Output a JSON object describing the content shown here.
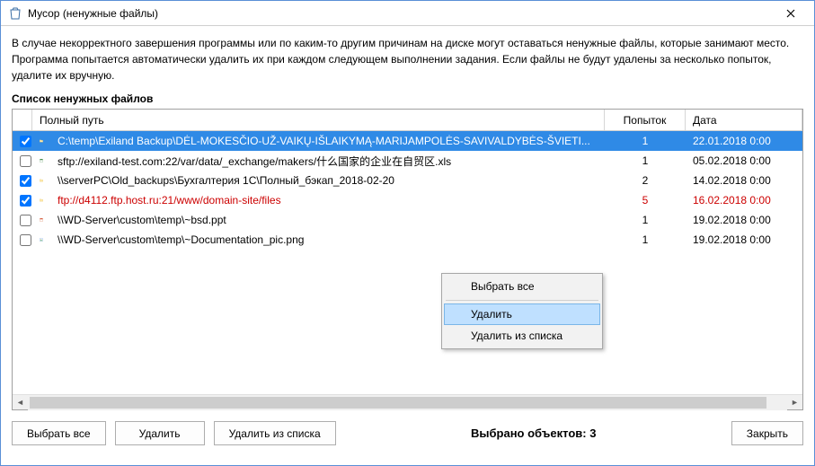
{
  "window": {
    "title": "Мусор (ненужные файлы)"
  },
  "description": "В случае некорректного завершения программы или по каким-то другим причинам на диске могут оставаться ненужные файлы, которые занимают место. Программа попытается автоматически удалить их при каждом следующем выполнении задания. Если файлы не будут удалены за несколько попыток, удалите их вручную.",
  "list_heading": "Список ненужных файлов",
  "columns": {
    "path": "Полный путь",
    "attempts": "Попыток",
    "date": "Дата"
  },
  "rows": [
    {
      "checked": true,
      "icon": "folder",
      "path": "C:\\temp\\Exiland Backup\\DĖL-MOKESČIO-UŽ-VAIKŲ-IŠLAIKYMĄ-MARIJAMPOLĖS-SAVIVALDYBĖS-ŠVIETI...",
      "attempts": "1",
      "date": "22.01.2018  0:00",
      "selected": true,
      "error": false
    },
    {
      "checked": false,
      "icon": "xls",
      "path": "sftp://exiland-test.com:22/var/data/_exchange/makers/什么国家的企业在自贸区.xls",
      "attempts": "1",
      "date": "05.02.2018  0:00",
      "selected": false,
      "error": false
    },
    {
      "checked": true,
      "icon": "folder",
      "path": "\\\\serverPC\\Old_backups\\Бухгалтерия 1С\\Полный_бэкап_2018-02-20",
      "attempts": "2",
      "date": "14.02.2018  0:00",
      "selected": false,
      "error": false
    },
    {
      "checked": true,
      "icon": "folder",
      "path": "ftp://d4112.ftp.host.ru:21/www/domain-site/files",
      "attempts": "5",
      "date": "16.02.2018  0:00",
      "selected": false,
      "error": true
    },
    {
      "checked": false,
      "icon": "ppt",
      "path": "\\\\WD-Server\\custom\\temp\\~bsd.ppt",
      "attempts": "1",
      "date": "19.02.2018  0:00",
      "selected": false,
      "error": false
    },
    {
      "checked": false,
      "icon": "img",
      "path": "\\\\WD-Server\\custom\\temp\\~Documentation_pic.png",
      "attempts": "1",
      "date": "19.02.2018  0:00",
      "selected": false,
      "error": false
    }
  ],
  "context_menu": {
    "select_all": "Выбрать все",
    "delete": "Удалить",
    "remove_from_list": "Удалить из списка",
    "hovered_index": 1
  },
  "footer": {
    "select_all": "Выбрать все",
    "delete": "Удалить",
    "remove_from_list": "Удалить из списка",
    "status": "Выбрано объектов: 3",
    "close": "Закрыть"
  }
}
